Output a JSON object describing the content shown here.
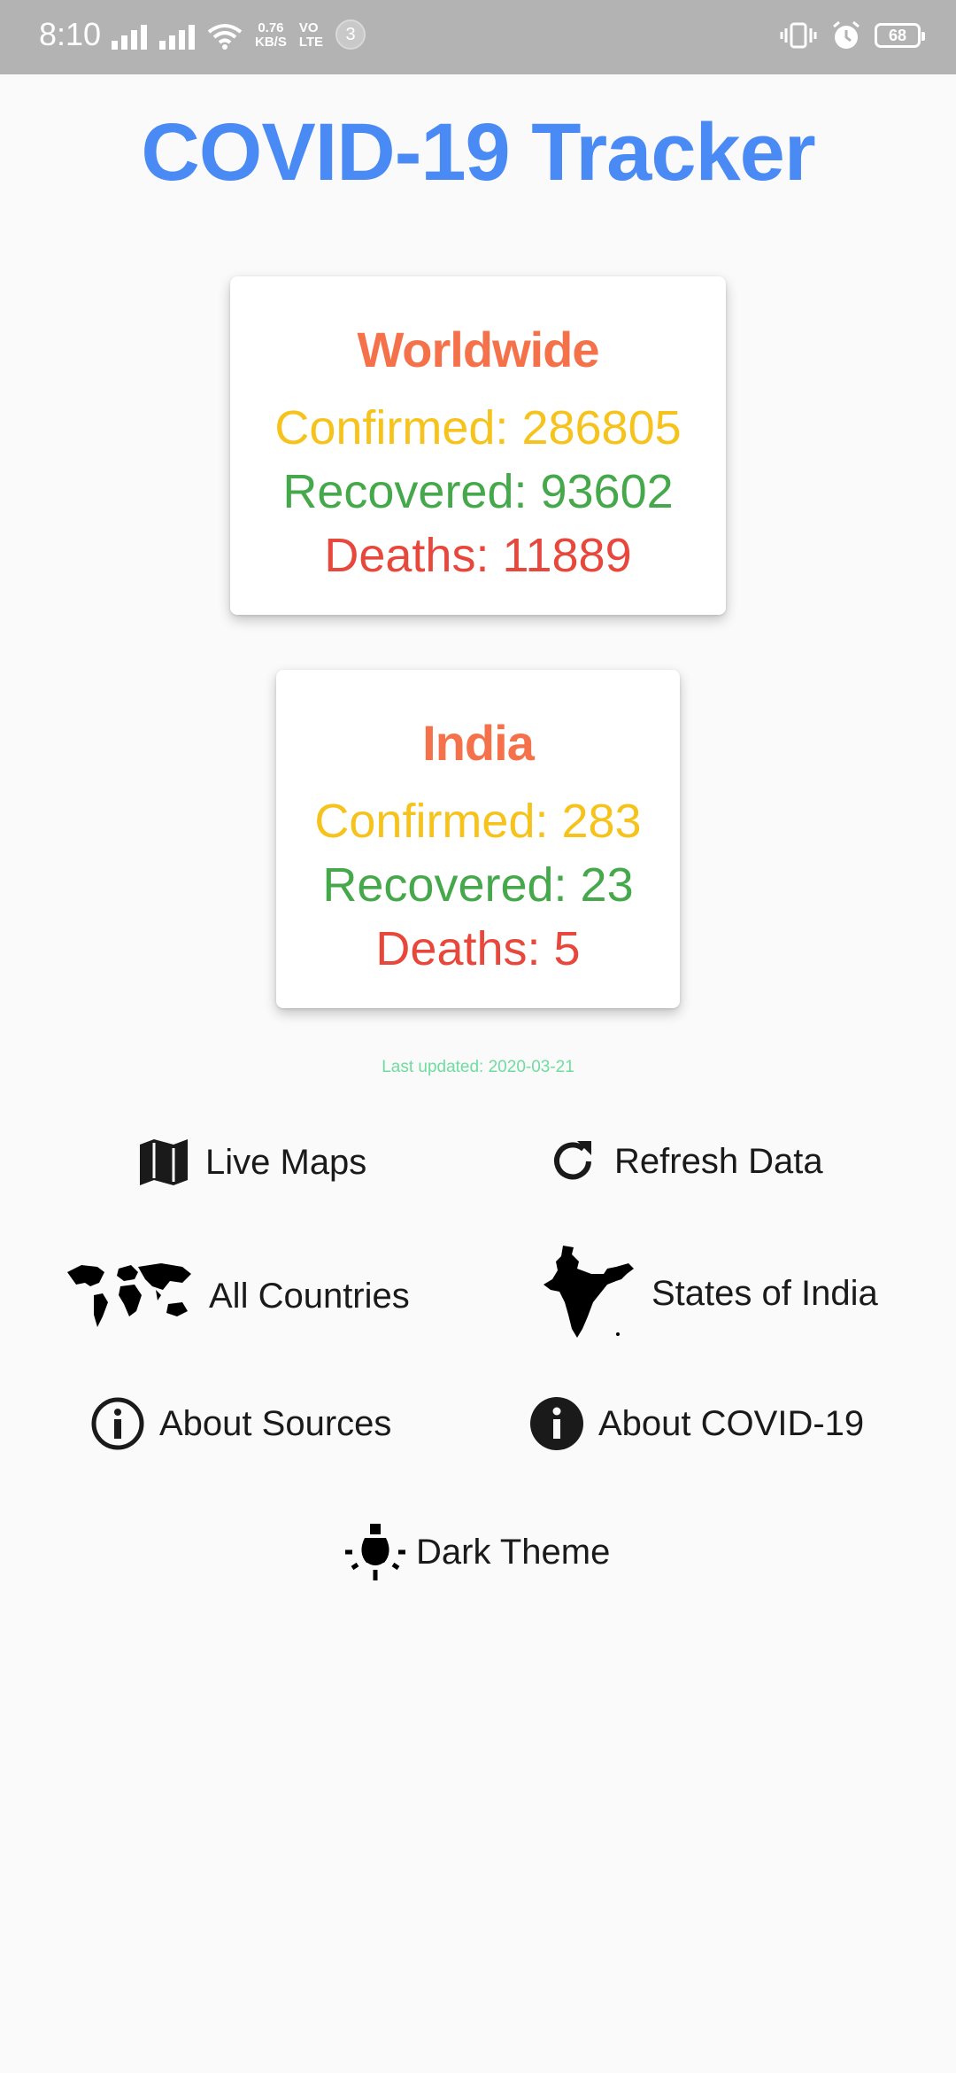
{
  "status_bar": {
    "time": "8:10",
    "speed_value": "0.76",
    "speed_unit": "KB/S",
    "volte_top": "VO",
    "volte_bottom": "LTE",
    "notification_count": "3",
    "battery": "68"
  },
  "app": {
    "title": "COVID-19 Tracker"
  },
  "worldwide": {
    "heading": "Worldwide",
    "confirmed": "Confirmed: 286805",
    "recovered": "Recovered: 93602",
    "deaths": "Deaths: 11889"
  },
  "india": {
    "heading": "India",
    "confirmed": "Confirmed: 283",
    "recovered": "Recovered: 23",
    "deaths": "Deaths: 5"
  },
  "last_updated": "Last updated: 2020-03-21",
  "menu": {
    "live_maps": "Live Maps",
    "refresh_data": "Refresh Data",
    "all_countries": "All Countries",
    "states_of_india": "States of India",
    "about_sources": "About Sources",
    "about_covid": "About COVID-19",
    "dark_theme": "Dark Theme"
  },
  "colors": {
    "title": "#4a8af4",
    "heading": "#f4714a",
    "confirmed": "#f6c31c",
    "recovered": "#45a84a",
    "deaths": "#e8473c",
    "updated": "#6fdca0"
  },
  "icons": [
    "map-icon",
    "refresh-icon",
    "world-map-icon",
    "india-map-icon",
    "info-outline-icon",
    "info-filled-icon",
    "bulb-icon"
  ]
}
